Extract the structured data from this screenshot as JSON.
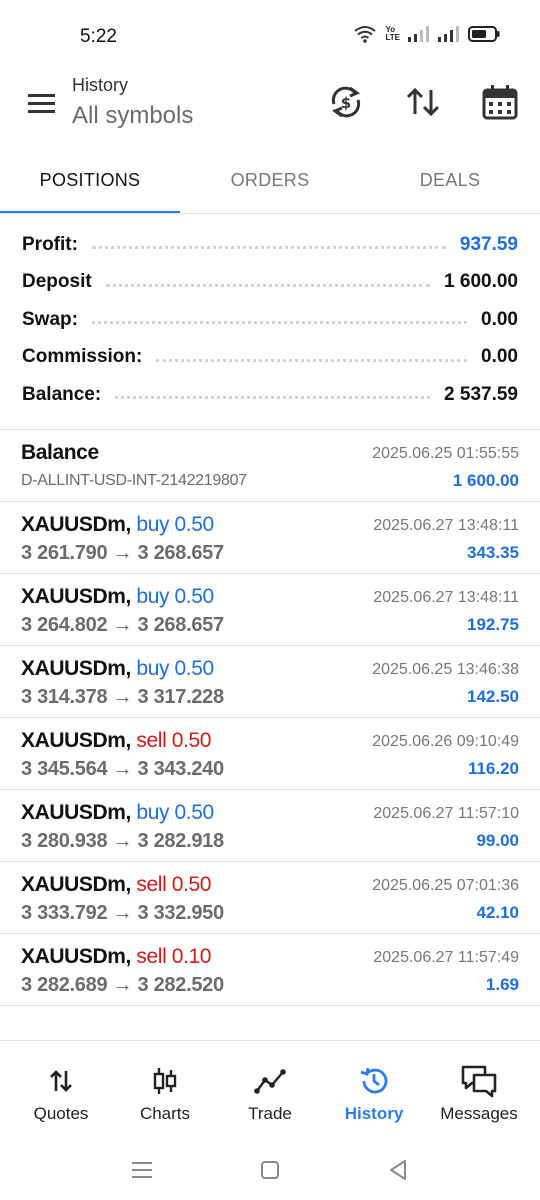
{
  "status_bar": {
    "time": "5:22",
    "network_label_top": "Yo",
    "network_label_bottom": "LTE"
  },
  "app_bar": {
    "title": "History",
    "subtitle": "All symbols",
    "icons": [
      "menu-icon",
      "currency-refresh-icon",
      "sort-icon",
      "calendar-icon"
    ]
  },
  "tabs": [
    {
      "label": "POSITIONS",
      "active": true
    },
    {
      "label": "ORDERS",
      "active": false
    },
    {
      "label": "DEALS",
      "active": false
    }
  ],
  "summary": {
    "profit": {
      "label": "Profit:",
      "value": "937.59",
      "color": "#1f6fd6"
    },
    "deposit": {
      "label": "Deposit",
      "value": "1 600.00"
    },
    "swap": {
      "label": "Swap:",
      "value": "0.00"
    },
    "commission": {
      "label": "Commission:",
      "value": "0.00"
    },
    "balance": {
      "label": "Balance:",
      "value": "2 537.59"
    }
  },
  "balance_entry": {
    "title": "Balance",
    "account": "D-ALLINT-USD-INT-2142219807",
    "time": "2025.06.25 01:55:55",
    "amount": "1 600.00"
  },
  "positions": [
    {
      "symbol": "XAUUSDm,",
      "type": "buy 0.50",
      "side": "buy",
      "open": "3 261.790",
      "close": "3 268.657",
      "time": "2025.06.27 13:48:11",
      "profit": "343.35"
    },
    {
      "symbol": "XAUUSDm,",
      "type": "buy 0.50",
      "side": "buy",
      "open": "3 264.802",
      "close": "3 268.657",
      "time": "2025.06.27 13:48:11",
      "profit": "192.75"
    },
    {
      "symbol": "XAUUSDm,",
      "type": "buy 0.50",
      "side": "buy",
      "open": "3 314.378",
      "close": "3 317.228",
      "time": "2025.06.25 13:46:38",
      "profit": "142.50"
    },
    {
      "symbol": "XAUUSDm,",
      "type": "sell 0.50",
      "side": "sell",
      "open": "3 345.564",
      "close": "3 343.240",
      "time": "2025.06.26 09:10:49",
      "profit": "116.20"
    },
    {
      "symbol": "XAUUSDm,",
      "type": "buy 0.50",
      "side": "buy",
      "open": "3 280.938",
      "close": "3 282.918",
      "time": "2025.06.27 11:57:10",
      "profit": "99.00"
    },
    {
      "symbol": "XAUUSDm,",
      "type": "sell 0.50",
      "side": "sell",
      "open": "3 333.792",
      "close": "3 332.950",
      "time": "2025.06.25 07:01:36",
      "profit": "42.10"
    },
    {
      "symbol": "XAUUSDm,",
      "type": "sell 0.10",
      "side": "sell",
      "open": "3 282.689",
      "close": "3 282.520",
      "time": "2025.06.27 11:57:49",
      "profit": "1.69"
    }
  ],
  "arrow": "→",
  "bottom_nav": [
    {
      "label": "Quotes",
      "icon": "quotes-arrows-icon",
      "active": false
    },
    {
      "label": "Charts",
      "icon": "candlestick-icon",
      "active": false
    },
    {
      "label": "Trade",
      "icon": "trade-line-icon",
      "active": false
    },
    {
      "label": "History",
      "icon": "history-clock-icon",
      "active": true
    },
    {
      "label": "Messages",
      "icon": "messages-icon",
      "active": false
    }
  ],
  "colors": {
    "accent": "#2b7de9",
    "buy": "#1f6fd6",
    "sell": "#cc1d1d",
    "profit": "#1f6fd6",
    "price_text": "#6c6c6c"
  }
}
